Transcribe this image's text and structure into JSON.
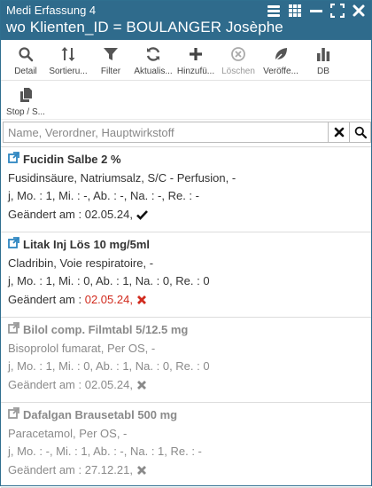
{
  "window": {
    "app_title": "Medi Erfassung 4",
    "subtitle": "wo Klienten_ID = BOULANGER Josèphe",
    "titlebar_color": "#2f6b8c"
  },
  "toolbar": {
    "buttons": [
      {
        "label": "Detail",
        "icon": "search-icon"
      },
      {
        "label": "Sortieru...",
        "icon": "sort-icon"
      },
      {
        "label": "Filter",
        "icon": "filter-icon"
      },
      {
        "label": "Aktualis...",
        "icon": "refresh-icon"
      },
      {
        "label": "Hinzufü...",
        "icon": "plus-icon"
      },
      {
        "label": "Löschen",
        "icon": "delete-icon",
        "disabled": true
      },
      {
        "label": "Veröffe...",
        "icon": "leaf-icon"
      },
      {
        "label": "DB",
        "icon": "bar-chart-icon"
      }
    ],
    "second_row": [
      {
        "label": "Stop / S...",
        "icon": "copy-icon"
      }
    ]
  },
  "search": {
    "placeholder": "Name, Verordner, Hauptwirkstoff",
    "value": ""
  },
  "items": [
    {
      "name": "Fucidin Salbe 2 %",
      "details": "Fusidinsäure, Natriumsalz, S/C - Perfusion, -",
      "dosage": "j, Mo. : 1, Mi. : -, Ab. : -, Na. : -, Re. : -",
      "changed_label": "Geändert am : ",
      "changed_date": "02.05.24,",
      "status": "check",
      "active": true
    },
    {
      "name": "Litak Inj Lös 10 mg/5ml",
      "details": "Cladribin, Voie respiratoire, -",
      "dosage": "j, Mo. : 1, Mi. : 0, Ab. : 1, Na. : 0, Re. : 0",
      "changed_label": "Geändert am : ",
      "changed_date": "02.05.24,",
      "status": "cross-red",
      "active": true
    },
    {
      "name": "Bilol comp. Filmtabl 5/12.5 mg",
      "details": "Bisoprolol fumarat, Per OS, -",
      "dosage": "j, Mo. : 1, Mi. : 0, Ab. : 1, Na. : 0, Re. : 0",
      "changed_label": "Geändert am : ",
      "changed_date": "02.05.24,",
      "status": "cross-grey",
      "active": false
    },
    {
      "name": "Dafalgan Brausetabl 500 mg",
      "details": "Paracetamol, Per OS, -",
      "dosage": "j, Mo. : -, Mi. : 1, Ab. : -, Na. : 1, Re. : -",
      "changed_label": "Geändert am : ",
      "changed_date": "27.12.21,",
      "status": "cross-grey",
      "active": false
    }
  ]
}
